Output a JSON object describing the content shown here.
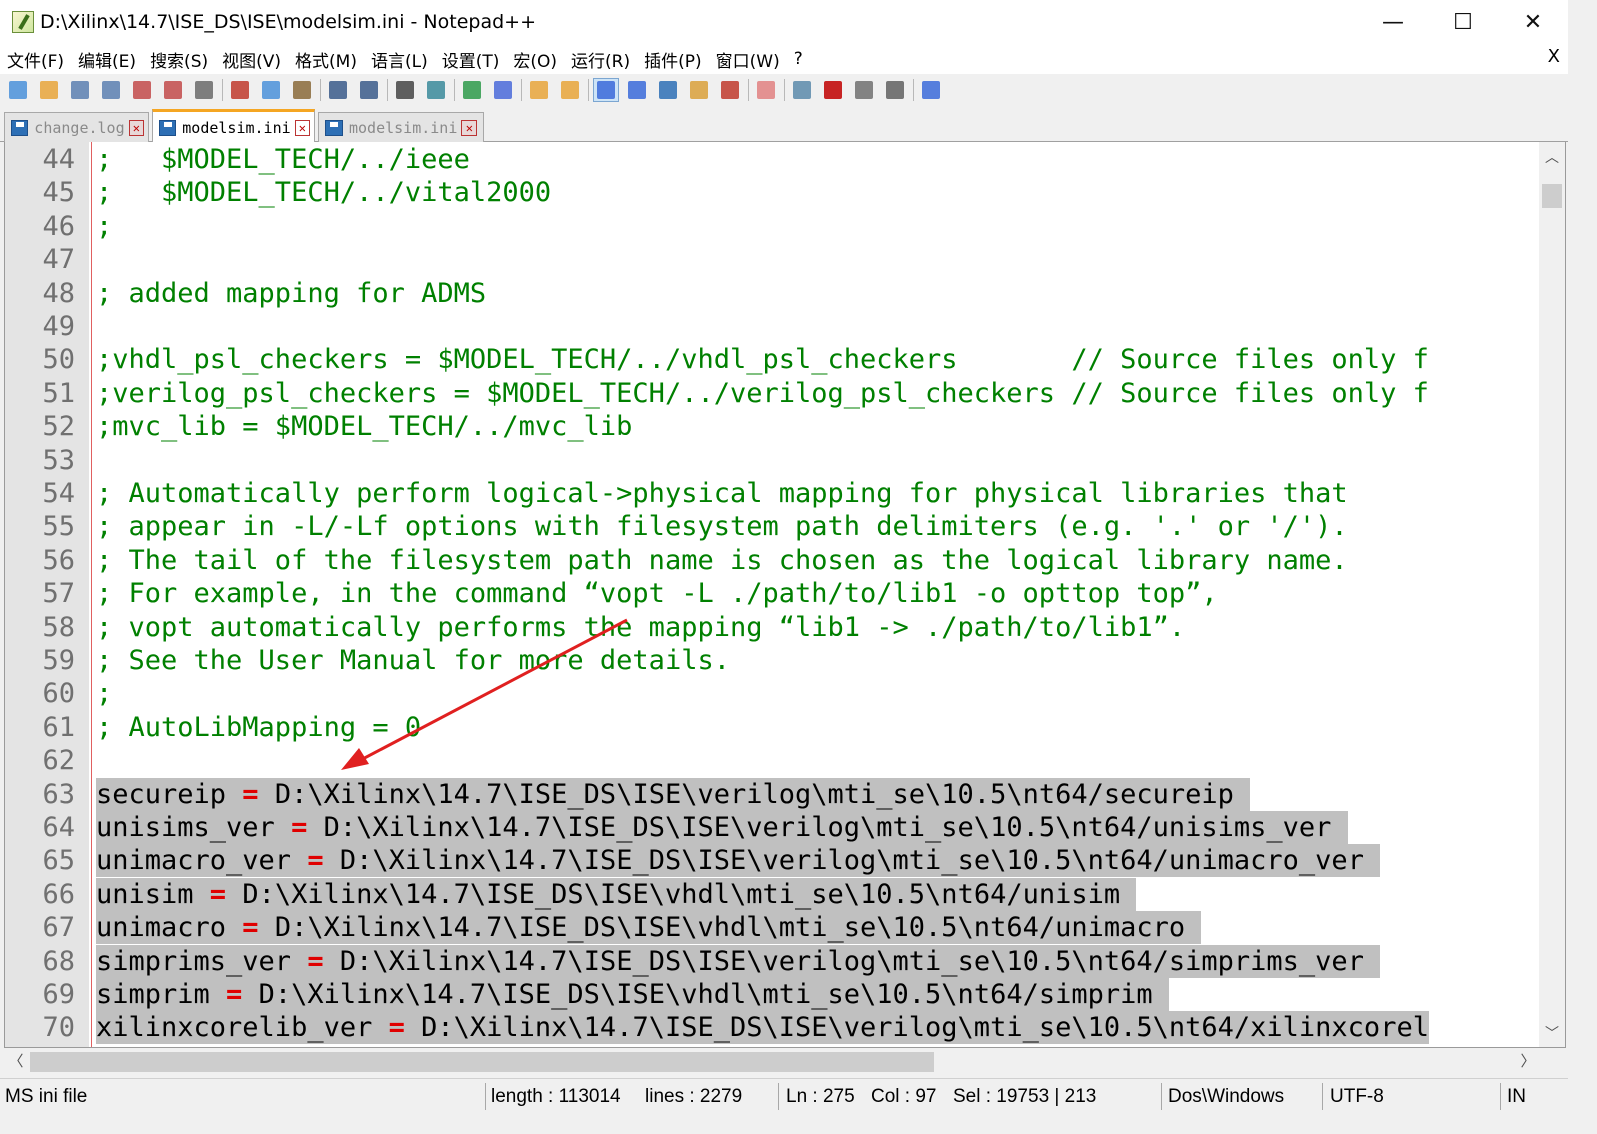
{
  "window": {
    "title": "D:\\Xilinx\\14.7\\ISE_DS\\ISE\\modelsim.ini - Notepad++",
    "minimize": "—",
    "maximize": "☐",
    "close": "✕"
  },
  "menu": {
    "items": [
      "文件(F)",
      "编辑(E)",
      "搜索(S)",
      "视图(V)",
      "格式(M)",
      "语言(L)",
      "设置(T)",
      "宏(O)",
      "运行(R)",
      "插件(P)",
      "窗口(W)",
      "?"
    ],
    "close_label": "X"
  },
  "toolbar": {
    "icons": [
      "new-file-icon",
      "open-file-icon",
      "save-icon",
      "save-all-icon",
      "close-icon",
      "close-all-icon",
      "print-icon",
      "cut-icon",
      "copy-icon",
      "paste-icon",
      "undo-icon",
      "redo-icon",
      "find-icon",
      "replace-icon",
      "zoom-in-icon",
      "zoom-out-icon",
      "sync-vertical-icon",
      "sync-horizontal-icon",
      "word-wrap-icon",
      "show-all-chars-icon",
      "indent-guide-icon",
      "document-map-icon",
      "function-list-icon",
      "folder-workspace-icon",
      "monitor-icon",
      "record-macro-icon",
      "stop-record-icon",
      "play-macro-icon",
      "run-macro-multiple-icon",
      "save-macro-icon"
    ]
  },
  "tabs": [
    {
      "label": "change.log",
      "active": false
    },
    {
      "label": "modelsim.ini",
      "active": true
    },
    {
      "label": "modelsim.ini",
      "active": false
    }
  ],
  "editor": {
    "lines": [
      {
        "n": "44",
        "text": ";   $MODEL_TECH/../ieee",
        "selected": false
      },
      {
        "n": "45",
        "text": ";   $MODEL_TECH/../vital2000",
        "selected": false
      },
      {
        "n": "46",
        "text": ";",
        "selected": false
      },
      {
        "n": "47",
        "text": "",
        "selected": false
      },
      {
        "n": "48",
        "text": "; added mapping for ADMS",
        "selected": false
      },
      {
        "n": "49",
        "text": "",
        "selected": false
      },
      {
        "n": "50",
        "text": ";vhdl_psl_checkers = $MODEL_TECH/../vhdl_psl_checkers       // Source files only f",
        "selected": false
      },
      {
        "n": "51",
        "text": ";verilog_psl_checkers = $MODEL_TECH/../verilog_psl_checkers // Source files only f",
        "selected": false
      },
      {
        "n": "52",
        "text": ";mvc_lib = $MODEL_TECH/../mvc_lib",
        "selected": false
      },
      {
        "n": "53",
        "text": "",
        "selected": false
      },
      {
        "n": "54",
        "text": "; Automatically perform logical->physical mapping for physical libraries that",
        "selected": false
      },
      {
        "n": "55",
        "text": "; appear in -L/-Lf options with filesystem path delimiters (e.g. '.' or '/').",
        "selected": false
      },
      {
        "n": "56",
        "text": "; The tail of the filesystem path name is chosen as the logical library name.",
        "selected": false
      },
      {
        "n": "57",
        "text": "; For example, in the command “vopt -L ./path/to/lib1 -o opttop top”,",
        "selected": false
      },
      {
        "n": "58",
        "text": "; vopt automatically performs the mapping “lib1 -> ./path/to/lib1”.",
        "selected": false
      },
      {
        "n": "59",
        "text": "; See the User Manual for more details.",
        "selected": false
      },
      {
        "n": "60",
        "text": ";",
        "selected": false
      },
      {
        "n": "61",
        "text": "; AutoLibMapping = 0",
        "selected": false
      },
      {
        "n": "62",
        "text": "",
        "selected": false
      },
      {
        "n": "63",
        "key": "secureip",
        "path": "D:\\Xilinx\\14.7\\ISE_DS\\ISE\\verilog\\mti_se\\10.5\\nt64/secureip ",
        "selected": true
      },
      {
        "n": "64",
        "key": "unisims_ver",
        "path": "D:\\Xilinx\\14.7\\ISE_DS\\ISE\\verilog\\mti_se\\10.5\\nt64/unisims_ver ",
        "selected": true
      },
      {
        "n": "65",
        "key": "unimacro_ver",
        "path": "D:\\Xilinx\\14.7\\ISE_DS\\ISE\\verilog\\mti_se\\10.5\\nt64/unimacro_ver ",
        "selected": true
      },
      {
        "n": "66",
        "key": "unisim",
        "path": "D:\\Xilinx\\14.7\\ISE_DS\\ISE\\vhdl\\mti_se\\10.5\\nt64/unisim ",
        "selected": true
      },
      {
        "n": "67",
        "key": "unimacro",
        "path": "D:\\Xilinx\\14.7\\ISE_DS\\ISE\\vhdl\\mti_se\\10.5\\nt64/unimacro ",
        "selected": true
      },
      {
        "n": "68",
        "key": "simprims_ver",
        "path": "D:\\Xilinx\\14.7\\ISE_DS\\ISE\\verilog\\mti_se\\10.5\\nt64/simprims_ver ",
        "selected": true
      },
      {
        "n": "69",
        "key": "simprim",
        "path": "D:\\Xilinx\\14.7\\ISE_DS\\ISE\\vhdl\\mti_se\\10.5\\nt64/simprim ",
        "selected": true
      },
      {
        "n": "70",
        "key": "xilinxcorelib_ver",
        "path": "D:\\Xilinx\\14.7\\ISE_DS\\ISE\\verilog\\mti_se\\10.5\\nt64/xilinxcorel",
        "selected": true
      }
    ]
  },
  "statusbar": {
    "filetype": "MS ini file",
    "length": "length : 113014",
    "lines": "lines : 2279",
    "ln": "Ln : 275",
    "col": "Col : 97",
    "sel": "Sel : 19753 | 213",
    "eol": "Dos\\Windows",
    "encoding": "UTF-8",
    "mode": "IN"
  },
  "colors": {
    "comment": "#008000",
    "operator": "#e00000",
    "selection": "#c0c0c0",
    "annotation_arrow": "#e02020"
  }
}
